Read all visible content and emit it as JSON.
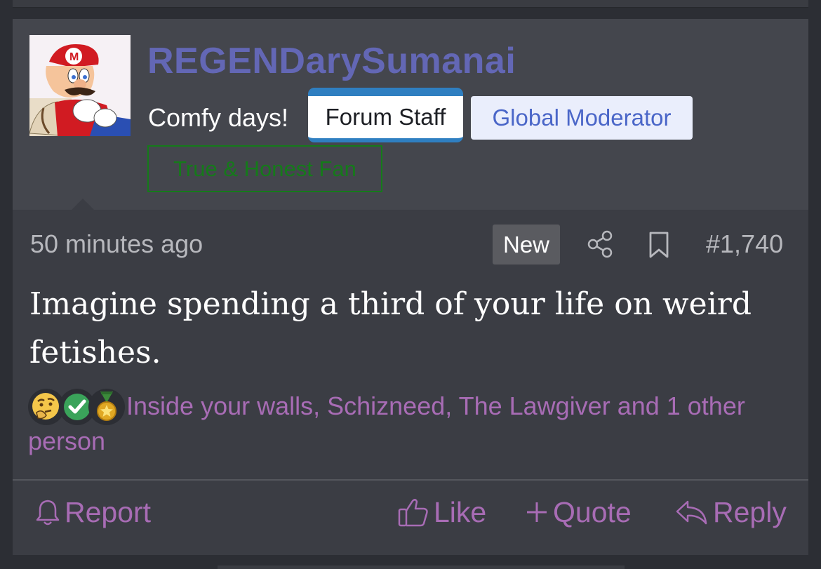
{
  "post": {
    "username": "REGENDarySumanai",
    "user_title": "Comfy days!",
    "badges": {
      "staff": "Forum Staff",
      "moderator": "Global Moderator",
      "fan": "True & Honest Fan"
    },
    "timestamp": "50 minutes ago",
    "new_label": "New",
    "post_number": "#1,740",
    "message": "Imagine spending a third of your life on weird fetishes.",
    "reactions": {
      "icons": [
        "thinking-face-icon",
        "check-mark-icon",
        "medal-icon"
      ],
      "text": "Inside your walls, Schizneed, The Lawgiver and 1 other person"
    },
    "actions": {
      "report": "Report",
      "like": "Like",
      "quote": "Quote",
      "reply": "Reply"
    }
  },
  "colors": {
    "username": "#6367b5",
    "action": "#a86cb5",
    "staff_badge": "#2f7fc1",
    "fan_badge": "#157a1a"
  }
}
